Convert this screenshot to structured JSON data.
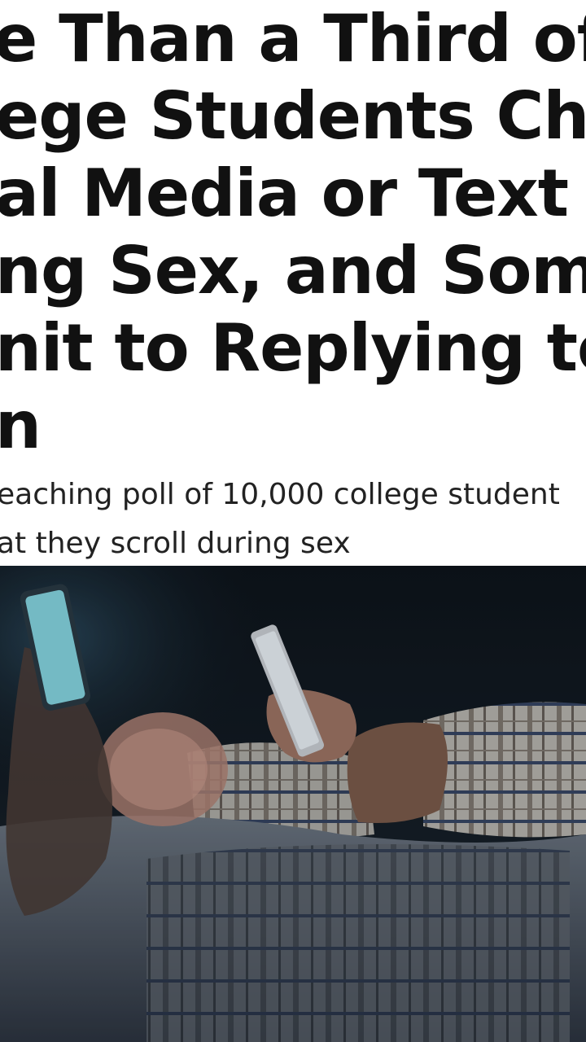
{
  "article": {
    "headline_lines": [
      "e Than a Third of",
      "ege Students Check",
      "al Media or Text",
      "ng Sex, and Some",
      "nit to Replying to",
      "n"
    ],
    "subtitle_lines": [
      "eaching poll of 10,000 college student",
      "at they scroll during sex"
    ]
  },
  "photo": {
    "subject": "couple-in-bed-using-phones"
  }
}
